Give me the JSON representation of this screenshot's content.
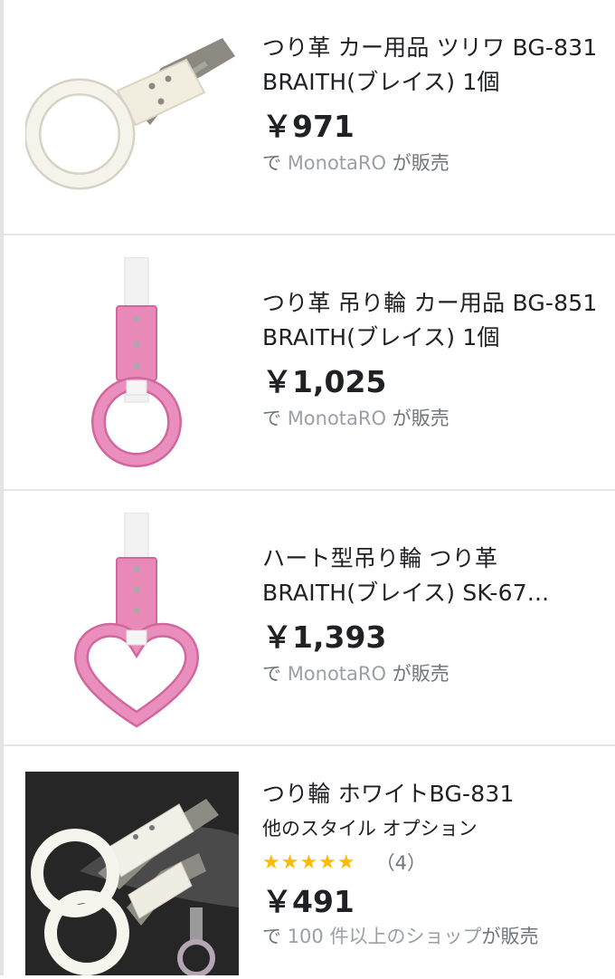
{
  "products": [
    {
      "title": "つり革 カー用品 ツリワ BG-831 BRAITH(ブレイス) 1個",
      "price": "￥971",
      "seller_prefix": "で ",
      "seller_name": "MonotaRO",
      "seller_suffix": " が販売",
      "image_icon": "white-strap-ring-icon",
      "image_color": "#f3f1e4"
    },
    {
      "title": "つり革 吊り輪 カー用品 BG-851 BRAITH(ブレイス) 1個",
      "price": "￥1,025",
      "seller_prefix": "で ",
      "seller_name": "MonotaRO",
      "seller_suffix": " が販売",
      "image_icon": "pink-strap-ring-icon",
      "image_color": "#e57fb0"
    },
    {
      "title_line1": "ハート型吊り輪 つり革",
      "title_line2": "BRAITH(ブレイス) SK-67...",
      "price": "￥1,393",
      "seller_prefix": "で ",
      "seller_name": "MonotaRO",
      "seller_suffix": " が販売",
      "image_icon": "pink-heart-strap-icon",
      "image_color": "#e57fb0"
    },
    {
      "title": "つり輪 ホワイトBG-831",
      "subtitle": "他のスタイル オプション",
      "stars": "★★★★★",
      "rating_value": 5,
      "review_count": "（4）",
      "price": "￥491",
      "seller_prefix": "で ",
      "seller_name": "100 件以上のショップ",
      "seller_suffix": "が販売",
      "image_icon": "white-rings-photo-icon"
    }
  ],
  "colors": {
    "star": "#fbbc04",
    "text": "#202124",
    "muted": "#70757a",
    "divider": "#e6e6e6"
  }
}
